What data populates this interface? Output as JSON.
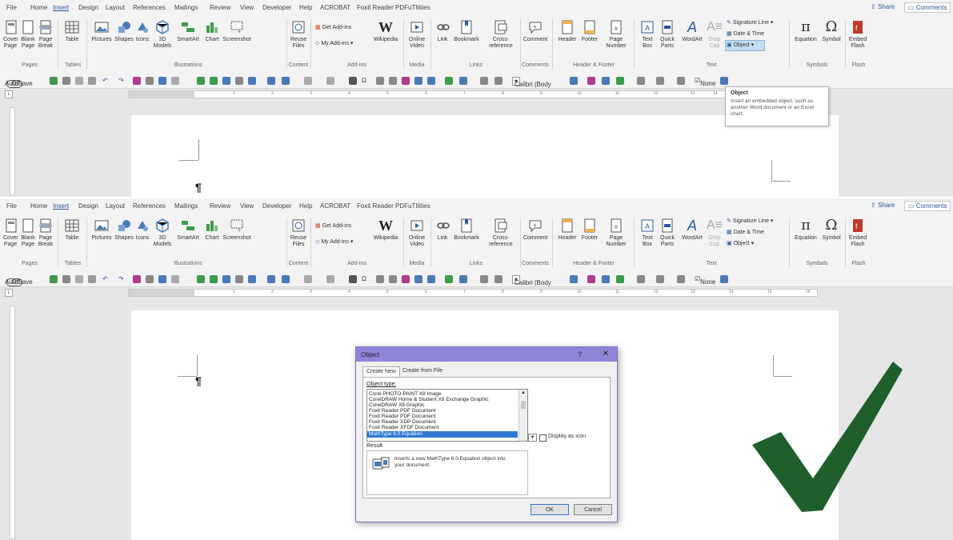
{
  "menu_tabs": [
    "File",
    "Home",
    "Insert",
    "Design",
    "Layout",
    "References",
    "Mailings",
    "Review",
    "View",
    "Developer",
    "Help",
    "ACROBAT",
    "Foxit Reader PDF",
    "uTIlities"
  ],
  "active_tab": "Insert",
  "share_label": "Share",
  "comments_label": "Comments",
  "ribbon": {
    "pages": {
      "cover_page": "Cover\nPage",
      "blank_page": "Blank\nPage",
      "page_break": "Page\nBreak",
      "group": "Pages"
    },
    "tables": {
      "table": "Table",
      "group": "Tables"
    },
    "illustrations": {
      "pictures": "Pictures",
      "shapes": "Shapes",
      "icons": "Icons",
      "models": "3D\nModels",
      "smartart": "SmartArt",
      "chart": "Chart",
      "screenshot": "Screenshot",
      "group": "Illustrations"
    },
    "content": {
      "reuse_files": "Reuse\nFiles",
      "group": "Content"
    },
    "addins": {
      "get_addins": "Get Add-ins",
      "my_addins": "My Add-ins",
      "wikipedia": "Wikipedia",
      "group": "Add-ins"
    },
    "media": {
      "online_video": "Online\nVideo",
      "group": "Media"
    },
    "links": {
      "link": "Link",
      "bookmark": "Bookmark",
      "cross_reference": "Cross-\nreference",
      "group": "Links"
    },
    "comments": {
      "comment": "Comment",
      "group": "Comments"
    },
    "header_footer": {
      "header": "Header",
      "footer": "Footer",
      "page_number": "Page\nNumber",
      "group": "Header & Footer"
    },
    "text": {
      "text_box": "Text\nBox",
      "quick_parts": "Quick\nParts",
      "wordart": "WordArt",
      "drop_cap": "Drop\nCap",
      "signature_line": "Signature Line",
      "date_time": "Date & Time",
      "object": "Object",
      "group": "Text"
    },
    "symbols": {
      "equation": "Equation",
      "symbol": "Symbol",
      "group": "Symbols"
    },
    "flash": {
      "embed_flash": "Embed\nFlash",
      "group": "Flash"
    }
  },
  "qat": {
    "autosave": "AutoSave",
    "autosave_state": "Off",
    "font": "Calibri (Body",
    "none_label": "None"
  },
  "ruler_numbers": [
    "1",
    "2",
    "3",
    "4",
    "5",
    "6",
    "7",
    "8",
    "9",
    "10",
    "11",
    "12",
    "13",
    "14",
    "15",
    "16"
  ],
  "tooltip": {
    "title": "Object",
    "body": "Insert an embedded object, such as another Word document or an Excel chart."
  },
  "dialog": {
    "title": "Object",
    "help": "?",
    "close": "✕",
    "tab_create_new": "Create New",
    "tab_create_from_file": "Create from File",
    "object_type_label": "Object type:",
    "items": [
      "Corel PHOTO-PAINT X8 Image",
      "CorelDRAW Home & Student X8 Exchange Graphic",
      "CorelDRAW X8 Graphic",
      "Foxit Reader PDF Document",
      "Foxit Reader PDF Document",
      "Foxit Reader XDP Document",
      "Foxit Reader XFDF Document",
      "MathType 6.0 Equation"
    ],
    "selected_item": "MathType 6.0 Equation",
    "display_as_icon": "Display as icon",
    "result_label": "Result",
    "result_text": "Inserts a new MathType 6.0 Equation object into your document.",
    "ok": "OK",
    "cancel": "Cancel"
  },
  "colors": {
    "accent": "#2b579a",
    "dialog_title": "#8f85d8",
    "selection": "#3078d4",
    "checkmark": "#1e5f2c"
  }
}
